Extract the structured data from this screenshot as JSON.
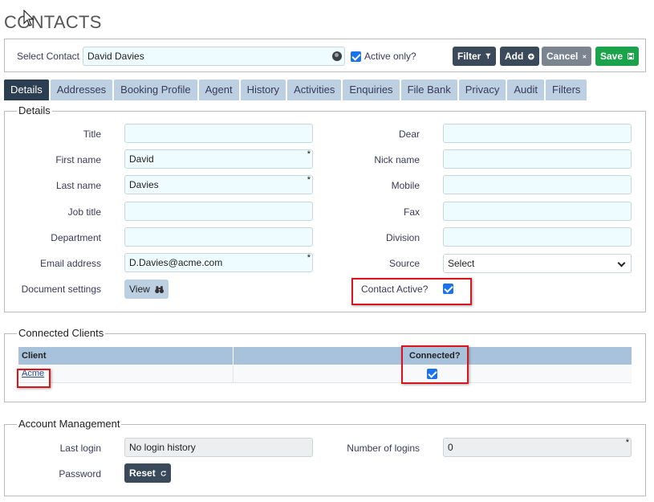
{
  "page": {
    "title": "CONTACTS"
  },
  "topbar": {
    "select_contact_label": "Select Contact",
    "select_contact_value": "David Davies",
    "active_only_label": "Active only?",
    "active_only_checked": true,
    "buttons": {
      "filter": "Filter",
      "add": "Add",
      "cancel": "Cancel",
      "save": "Save"
    }
  },
  "tabs": [
    "Details",
    "Addresses",
    "Booking Profile",
    "Agent",
    "History",
    "Activities",
    "Enquiries",
    "File Bank",
    "Privacy",
    "Audit",
    "Filters"
  ],
  "details": {
    "legend": "Details",
    "left": [
      {
        "label": "Title",
        "value": "",
        "required": false
      },
      {
        "label": "First name",
        "value": "David",
        "required": true
      },
      {
        "label": "Last name",
        "value": "Davies",
        "required": true
      },
      {
        "label": "Job title",
        "value": "",
        "required": false
      },
      {
        "label": "Department",
        "value": "",
        "required": false
      },
      {
        "label": "Email address",
        "value": "D.Davies@acme.com",
        "required": true
      }
    ],
    "right": [
      {
        "label": "Dear",
        "value": ""
      },
      {
        "label": "Nick name",
        "value": ""
      },
      {
        "label": "Mobile",
        "value": ""
      },
      {
        "label": "Fax",
        "value": ""
      },
      {
        "label": "Division",
        "value": ""
      }
    ],
    "source_label": "Source",
    "source_value": "Select",
    "document_settings_label": "Document settings",
    "view_button": "View",
    "contact_active_label": "Contact Active?",
    "contact_active_checked": true
  },
  "connected_clients": {
    "legend": "Connected Clients",
    "columns": [
      "Client",
      "",
      "Connected?"
    ],
    "rows": [
      {
        "client": "Acme",
        "connected": true
      }
    ]
  },
  "account": {
    "legend": "Account Management",
    "last_login_label": "Last login",
    "last_login_value": "No login history",
    "logins_label": "Number of logins",
    "logins_value": "0",
    "password_label": "Password",
    "reset_button": "Reset"
  },
  "colors": {
    "accent": "#2c3e52",
    "save": "#1aa34a",
    "tab": "#bcd0e2",
    "field": "#eefcff",
    "highlight": "#d9151b"
  }
}
